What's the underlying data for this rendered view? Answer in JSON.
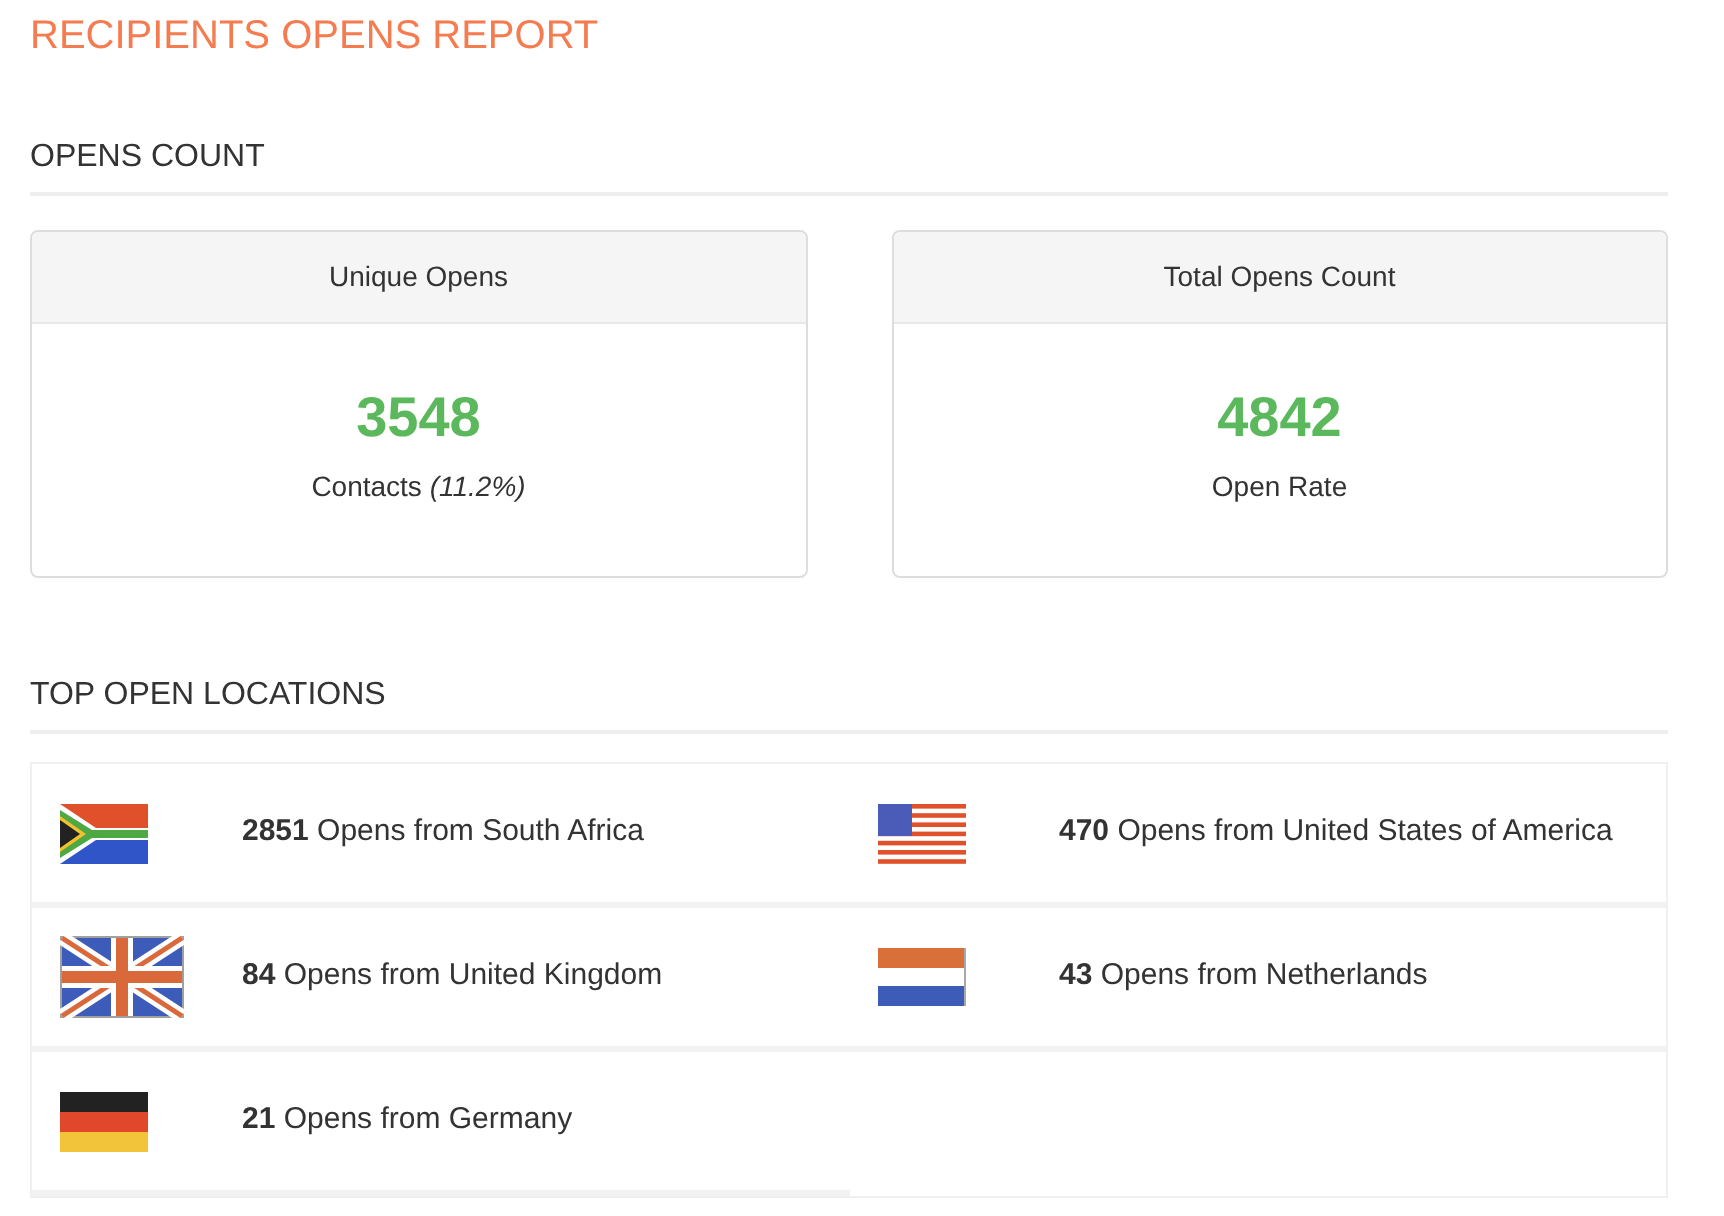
{
  "title": "RECIPIENTS OPENS REPORT",
  "opens_count": {
    "heading": "OPENS COUNT",
    "cards": [
      {
        "header": "Unique Opens",
        "value": "3548",
        "caption": "Contacts *(11.2%)*"
      },
      {
        "header": "Total Opens Count",
        "value": "4842",
        "caption": "Open Rate"
      }
    ]
  },
  "top_open_locations": {
    "heading": "TOP OPEN LOCATIONS",
    "locations": [
      {
        "kind": "za",
        "text": "**2851** Opens from South Africa"
      },
      {
        "kind": "us",
        "text": "**470** Opens from United States of America"
      },
      {
        "kind": "gb",
        "text": "**84** Opens from United Kingdom"
      },
      {
        "kind": "nl",
        "text": "**43** Opens from Netherlands"
      },
      {
        "kind": "de",
        "text": "**21** Opens from Germany"
      }
    ]
  }
}
